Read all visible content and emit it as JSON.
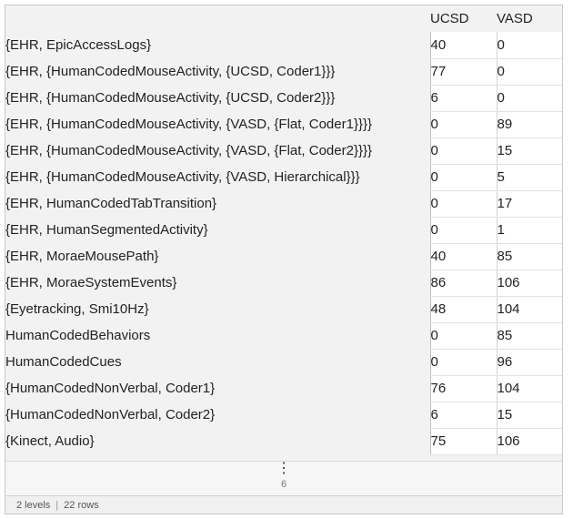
{
  "columns": [
    "UCSD",
    "VASD"
  ],
  "rows": [
    {
      "key": "{EHR, EpicAccessLogs}",
      "ucsd": "40",
      "vasd": "0"
    },
    {
      "key": "{EHR, {HumanCodedMouseActivity, {UCSD, Coder1}}}",
      "ucsd": "77",
      "vasd": "0"
    },
    {
      "key": "{EHR, {HumanCodedMouseActivity, {UCSD, Coder2}}}",
      "ucsd": "6",
      "vasd": "0"
    },
    {
      "key": "{EHR, {HumanCodedMouseActivity, {VASD, {Flat, Coder1}}}}",
      "ucsd": "0",
      "vasd": "89"
    },
    {
      "key": "{EHR, {HumanCodedMouseActivity, {VASD, {Flat, Coder2}}}}",
      "ucsd": "0",
      "vasd": "15"
    },
    {
      "key": "{EHR, {HumanCodedMouseActivity, {VASD, Hierarchical}}}",
      "ucsd": "0",
      "vasd": "5"
    },
    {
      "key": "{EHR, HumanCodedTabTransition}",
      "ucsd": "0",
      "vasd": "17"
    },
    {
      "key": "{EHR, HumanSegmentedActivity}",
      "ucsd": "0",
      "vasd": "1"
    },
    {
      "key": "{EHR, MoraeMousePath}",
      "ucsd": "40",
      "vasd": "85"
    },
    {
      "key": "{EHR, MoraeSystemEvents}",
      "ucsd": "86",
      "vasd": "106"
    },
    {
      "key": "{Eyetracking, Smi10Hz}",
      "ucsd": "48",
      "vasd": "104"
    },
    {
      "key": "HumanCodedBehaviors",
      "ucsd": "0",
      "vasd": "85"
    },
    {
      "key": "HumanCodedCues",
      "ucsd": "0",
      "vasd": "96"
    },
    {
      "key": "{HumanCodedNonVerbal, Coder1}",
      "ucsd": "76",
      "vasd": "104"
    },
    {
      "key": "{HumanCodedNonVerbal, Coder2}",
      "ucsd": "6",
      "vasd": "15"
    },
    {
      "key": "{Kinect, Audio}",
      "ucsd": "75",
      "vasd": "106"
    }
  ],
  "ellipsis": {
    "dots": "⋮",
    "hidden_count": "6"
  },
  "footer": {
    "levels": "2 levels",
    "separator": "|",
    "rows": "22 rows"
  }
}
